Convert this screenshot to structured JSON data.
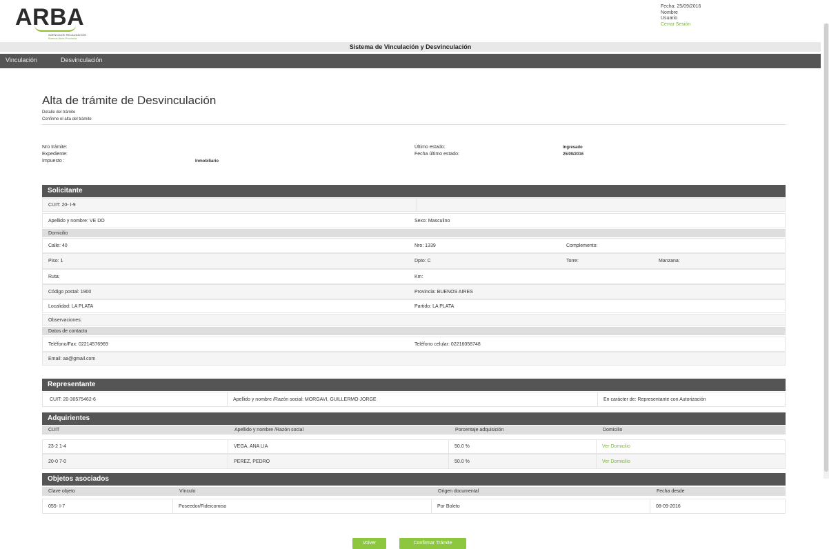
{
  "header": {
    "logo_text": "ARBA",
    "logo_sub1": "AGENCIA DE RECAUDACIÓN",
    "logo_sub2": "Buenos Aires Provincia",
    "fecha": "Fecha: 25/09/2016",
    "nombre": "Nombre",
    "usuario": "Usuario",
    "logout": "Cerrar Sesión"
  },
  "title_bar": "Sistema de Vinculación y Desvinculación",
  "nav": [
    "Vinculación",
    "Desvinculación"
  ],
  "page": {
    "title": "Alta de trámite de  Desvinculación",
    "subtitle1": "Detalle del trámite",
    "subtitle2": "Confirme el alta del trámite"
  },
  "meta": {
    "nro_tramite": "Nro trámite:",
    "expediente": "Expediente:",
    "impuesto": "Impuesto :",
    "impuesto_val": "Inmobiliario",
    "ultimo_estado": "Último estado:",
    "ultimo_estado_val": "Ingresado",
    "fecha_estado": "Fecha último estado:",
    "fecha_estado_val": "25/09/2016"
  },
  "solicitante": {
    "header": "Solicitante",
    "cuit": "CUIT:  20-            I-9",
    "apellido": "Apellido y nombre:  VE                               DO",
    "sexo": "Sexo:   Masculino",
    "domicilio": "Domicilio",
    "calle": "Calle: 40",
    "nro": "Nro: 1339",
    "complemento": "Complemento:",
    "piso": "Piso: 1",
    "dpto": "Dpto: C",
    "torre": "Torre:",
    "manzana": "Manzana:",
    "ruta": "Ruta:",
    "km": "Km:",
    "codigo_postal": "Código postal: 1900",
    "provincia": "Provincia: BUENOS AIRES",
    "localidad": "Localidad: LA PLATA",
    "partido": "Partido: LA PLATA",
    "observaciones": "Observaciones:",
    "datos_contacto": "Datos de contacto",
    "telefono": "Teléfono/Fax: 02214576969",
    "celular": "Teléfono celular: 02216058748",
    "email": "Email: aa@gmail.com"
  },
  "representante": {
    "header": "Representante",
    "cuit": "CUIT: 20-30575462-6",
    "nombre": "Apellido y nombre /Razón social: MORGAVI, GUILLERMO JORGE",
    "caracter": "En carácter de: Representante con Autorización"
  },
  "adquirientes": {
    "header": "Adquirientes",
    "columns": [
      "CUIT",
      "Apellido y nombre /Razón social",
      "Porcentaje adquisición",
      "Domicilio"
    ],
    "rows": [
      [
        "23-2          1-4",
        "VEGA, ANA LIA",
        "50.0 %",
        "Ver Domicilio"
      ],
      [
        "20-0          7-0",
        "PEREZ, PEDRO",
        "50.0 %",
        "Ver Domicilio"
      ]
    ]
  },
  "objetos": {
    "header": "Objetos asociados",
    "columns": [
      "Clave objeto",
      "Vínculo",
      "Origen documental",
      "Fecha desde"
    ],
    "rows": [
      [
        "055-          I-7",
        "Poseedor/Fideicomiso",
        "Por Boleto",
        "08-09-2016"
      ]
    ]
  },
  "buttons": {
    "volver": "Volver",
    "confirmar": "Confirmar Trámite"
  }
}
